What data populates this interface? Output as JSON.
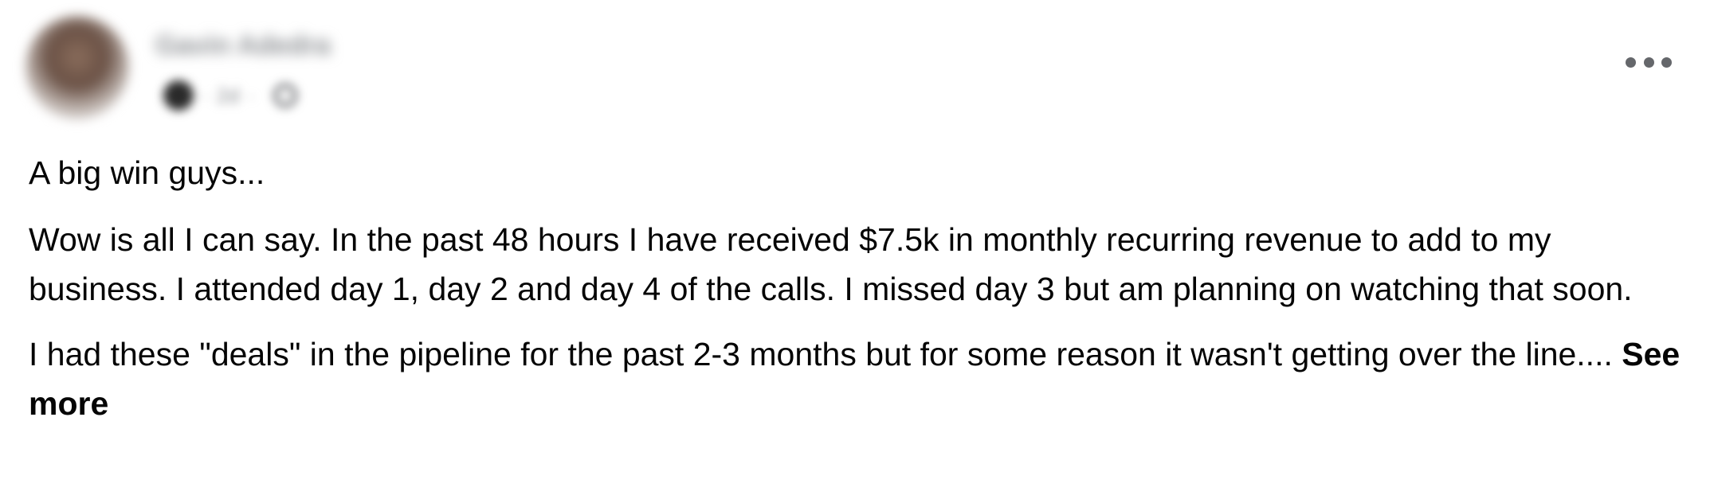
{
  "post": {
    "author": {
      "name": "Gavin Adedra",
      "time": "2d"
    },
    "paragraphs": [
      "A big win guys...",
      "Wow is all I can say. In the past 48 hours I have received $7.5k in monthly recurring revenue to add to my business. I attended day 1, day 2 and day 4 of the calls. I missed day 3 but am planning on watching that soon.",
      "I had these \"deals\" in the pipeline for the past 2-3 months but for some reason it wasn't getting over the line...."
    ],
    "see_more_label": "See more",
    "icons": {
      "more": "more-horizontal-icon",
      "audience": "globe-icon"
    },
    "colors": {
      "text": "#050505",
      "secondary": "#65676b"
    }
  }
}
